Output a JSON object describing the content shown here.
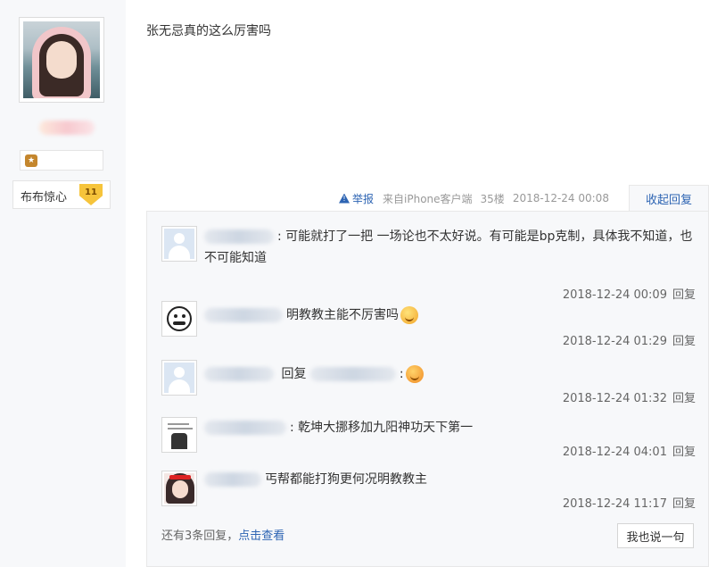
{
  "post": {
    "content": "张无忌真的这么厉害吗",
    "report_label": "举报",
    "source": "来自iPhone客户端",
    "floor": "35楼",
    "time": "2018-12-24 00:08",
    "collapse_label": "收起回复"
  },
  "author": {
    "grade_name": "布布惊心",
    "level": "11"
  },
  "replies": [
    {
      "text": ": 可能就打了一把 一场论也不太好说。有可能是bp克制，具体我不知道，也不可能知道",
      "time": "2018-12-24 00:09",
      "reply_label": "回复",
      "avatar": "default-user-icon"
    },
    {
      "text": "明教教主能不厉害吗",
      "time": "2018-12-24 01:29",
      "reply_label": "回复",
      "avatar": "meme-face-icon"
    },
    {
      "prefix": "回复",
      "text": ":",
      "time": "2018-12-24 01:32",
      "reply_label": "回复",
      "avatar": "default-user-icon"
    },
    {
      "text": ": 乾坤大挪移加九阳神功天下第一",
      "time": "2018-12-24 04:01",
      "reply_label": "回复",
      "avatar": "text-meme-icon"
    },
    {
      "text": "丐帮都能打狗更何况明教教主",
      "time": "2018-12-24 11:17",
      "reply_label": "回复",
      "avatar": "girl-photo-icon"
    }
  ],
  "footer": {
    "more_prefix": "还有3条回复，",
    "more_link": "点击查看",
    "say_button": "我也说一句"
  },
  "colors": {
    "link": "#2d64b3",
    "panel_bg": "#f7f8fa"
  }
}
